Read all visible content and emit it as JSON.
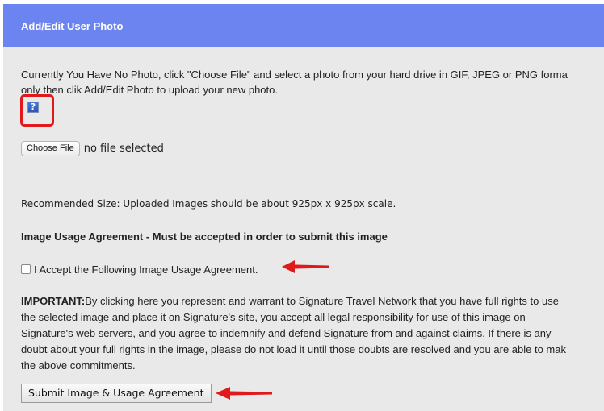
{
  "header": {
    "title": "Add/Edit User Photo"
  },
  "intro": {
    "line1": "Currently You Have No Photo, click \"Choose File\" and select a photo from your hard drive in GIF, JPEG or PNG forma",
    "line2": "only then clik Add/Edit Photo to upload your new photo."
  },
  "photo": {
    "placeholder_glyph": "?",
    "icon": "broken-image-icon"
  },
  "file_input": {
    "button_label": "Choose File",
    "status": "no file selected"
  },
  "recommended_text": "Recommended Size: Uploaded Images should be about 925px x 925px scale.",
  "agreement": {
    "heading": "Image Usage Agreement - Must be accepted in order to submit this image",
    "checkbox_label": "I Accept the Following Image Usage Agreement.",
    "checked": false,
    "important_label": "IMPORTANT:",
    "important_lines": [
      "By clicking here you represent and warrant to Signature Travel Network that you have full rights to use",
      "the selected image and place it on Signature's site, you accept all legal responsibility for use of this image on",
      "Signature's web servers, and you agree to indemnify and defend Signature from and against claims. If there is any",
      "doubt about your full rights in the image, please do not load it until those doubts are resolved and you are able to mak",
      "the above commitments."
    ]
  },
  "submit": {
    "label": "Submit Image & Usage Agreement"
  },
  "colors": {
    "header_bg": "#6b84f0",
    "panel_bg": "#e9e9e9",
    "annotation_red": "#e01a1a"
  }
}
